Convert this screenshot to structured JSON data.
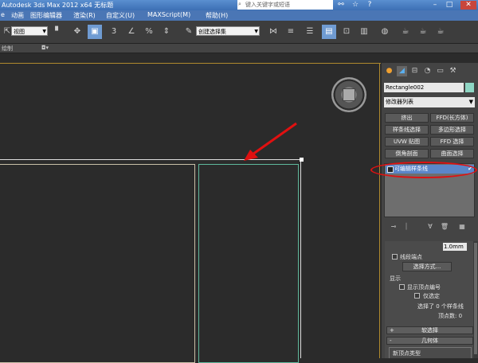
{
  "titlebar": {
    "title": "Autodesk 3ds Max  2012 x64     无标题",
    "search_placeholder": "键入关键字或短语",
    "icons": [
      "binoculars-icon",
      "star-icon",
      "help-icon",
      "minimize-icon",
      "maximize-icon",
      "close-icon"
    ]
  },
  "menubar": {
    "items": [
      "e",
      "动画",
      "图形编辑器",
      "渲染(R)",
      "自定义(U)",
      "MAXScript(M)",
      "帮助(H)"
    ]
  },
  "toolbar": {
    "view_dropdown": "视图",
    "selection_set_dropdown": "创建选择集",
    "accent_color": "#6f9bd2"
  },
  "ribbon": {
    "label": "绘制"
  },
  "command_panel": {
    "object_name": "Rectangle002",
    "object_color": "#8fd6c4",
    "modifier_list": "修改器列表",
    "modifier_buttons": [
      "挤出",
      "FFD(长方体)",
      "样条线选择",
      "多边形选择",
      "UVW 贴图",
      "FFD 选择",
      "倒角剖面",
      "曲面选择"
    ],
    "stack_item": "可编辑样条线",
    "highlight_color": "#e01010",
    "lower": {
      "area_select_value": "1.0mm",
      "segment_end": "线段端点",
      "select_by": "选择方式...",
      "display_header": "显示",
      "show_vertex_numbers": "显示顶点编号",
      "selected_only": "仅选定",
      "selection_status": "选择了 0 个样条线",
      "vertex_count": "顶点数: 0",
      "rollout_soft": "软选择",
      "rollout_geometry": "几何体",
      "new_vertex_type": "新顶点类型"
    }
  }
}
